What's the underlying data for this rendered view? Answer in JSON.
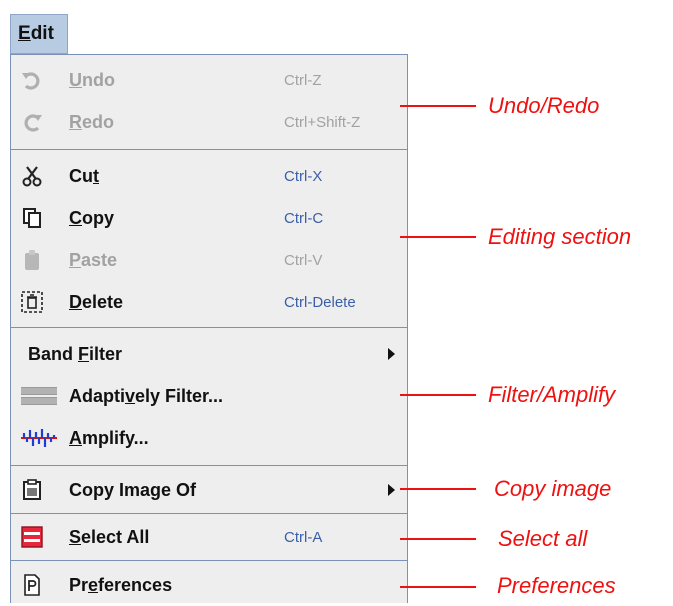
{
  "menubar": {
    "edit_mnemonic": "E",
    "edit_rest": "dit"
  },
  "menu": {
    "undo": {
      "mn": "U",
      "rest": "ndo",
      "accel": "Ctrl-Z"
    },
    "redo": {
      "mn": "R",
      "rest": "edo",
      "accel": "Ctrl+Shift-Z"
    },
    "cut": {
      "pre": "Cu",
      "mn": "t",
      "accel": "Ctrl-X"
    },
    "copy": {
      "mn": "C",
      "rest": "opy",
      "accel": "Ctrl-C"
    },
    "paste": {
      "mn": "P",
      "rest": "aste",
      "accel": "Ctrl-V"
    },
    "delete": {
      "mn": "D",
      "rest": "elete",
      "accel": "Ctrl-Delete"
    },
    "band_filter": {
      "pre": "Band ",
      "mn": "F",
      "rest": "ilter"
    },
    "adaptively_filter": {
      "pre": "Adapti",
      "mn": "v",
      "rest": "ely Filter..."
    },
    "amplify": {
      "mn": "A",
      "rest": "mplify..."
    },
    "copy_image_of": {
      "label": "Copy Image Of"
    },
    "select_all": {
      "mn": "S",
      "rest": "elect All",
      "accel": "Ctrl-A"
    },
    "preferences": {
      "pre": "Pr",
      "mn": "e",
      "rest": "ferences"
    }
  },
  "annotations": {
    "undo_redo": "Undo/Redo",
    "editing": "Editing section",
    "filter_amplify": "Filter/Amplify",
    "copy_image": "Copy image",
    "select_all": "Select all",
    "preferences": "Preferences"
  },
  "colors": {
    "annotation": "#ee1111",
    "accelerator": "#3a5fa8",
    "disabled": "#a2a2a2",
    "menu_bg": "#eeeeee",
    "menubar_highlight": "#b7cbe3"
  }
}
